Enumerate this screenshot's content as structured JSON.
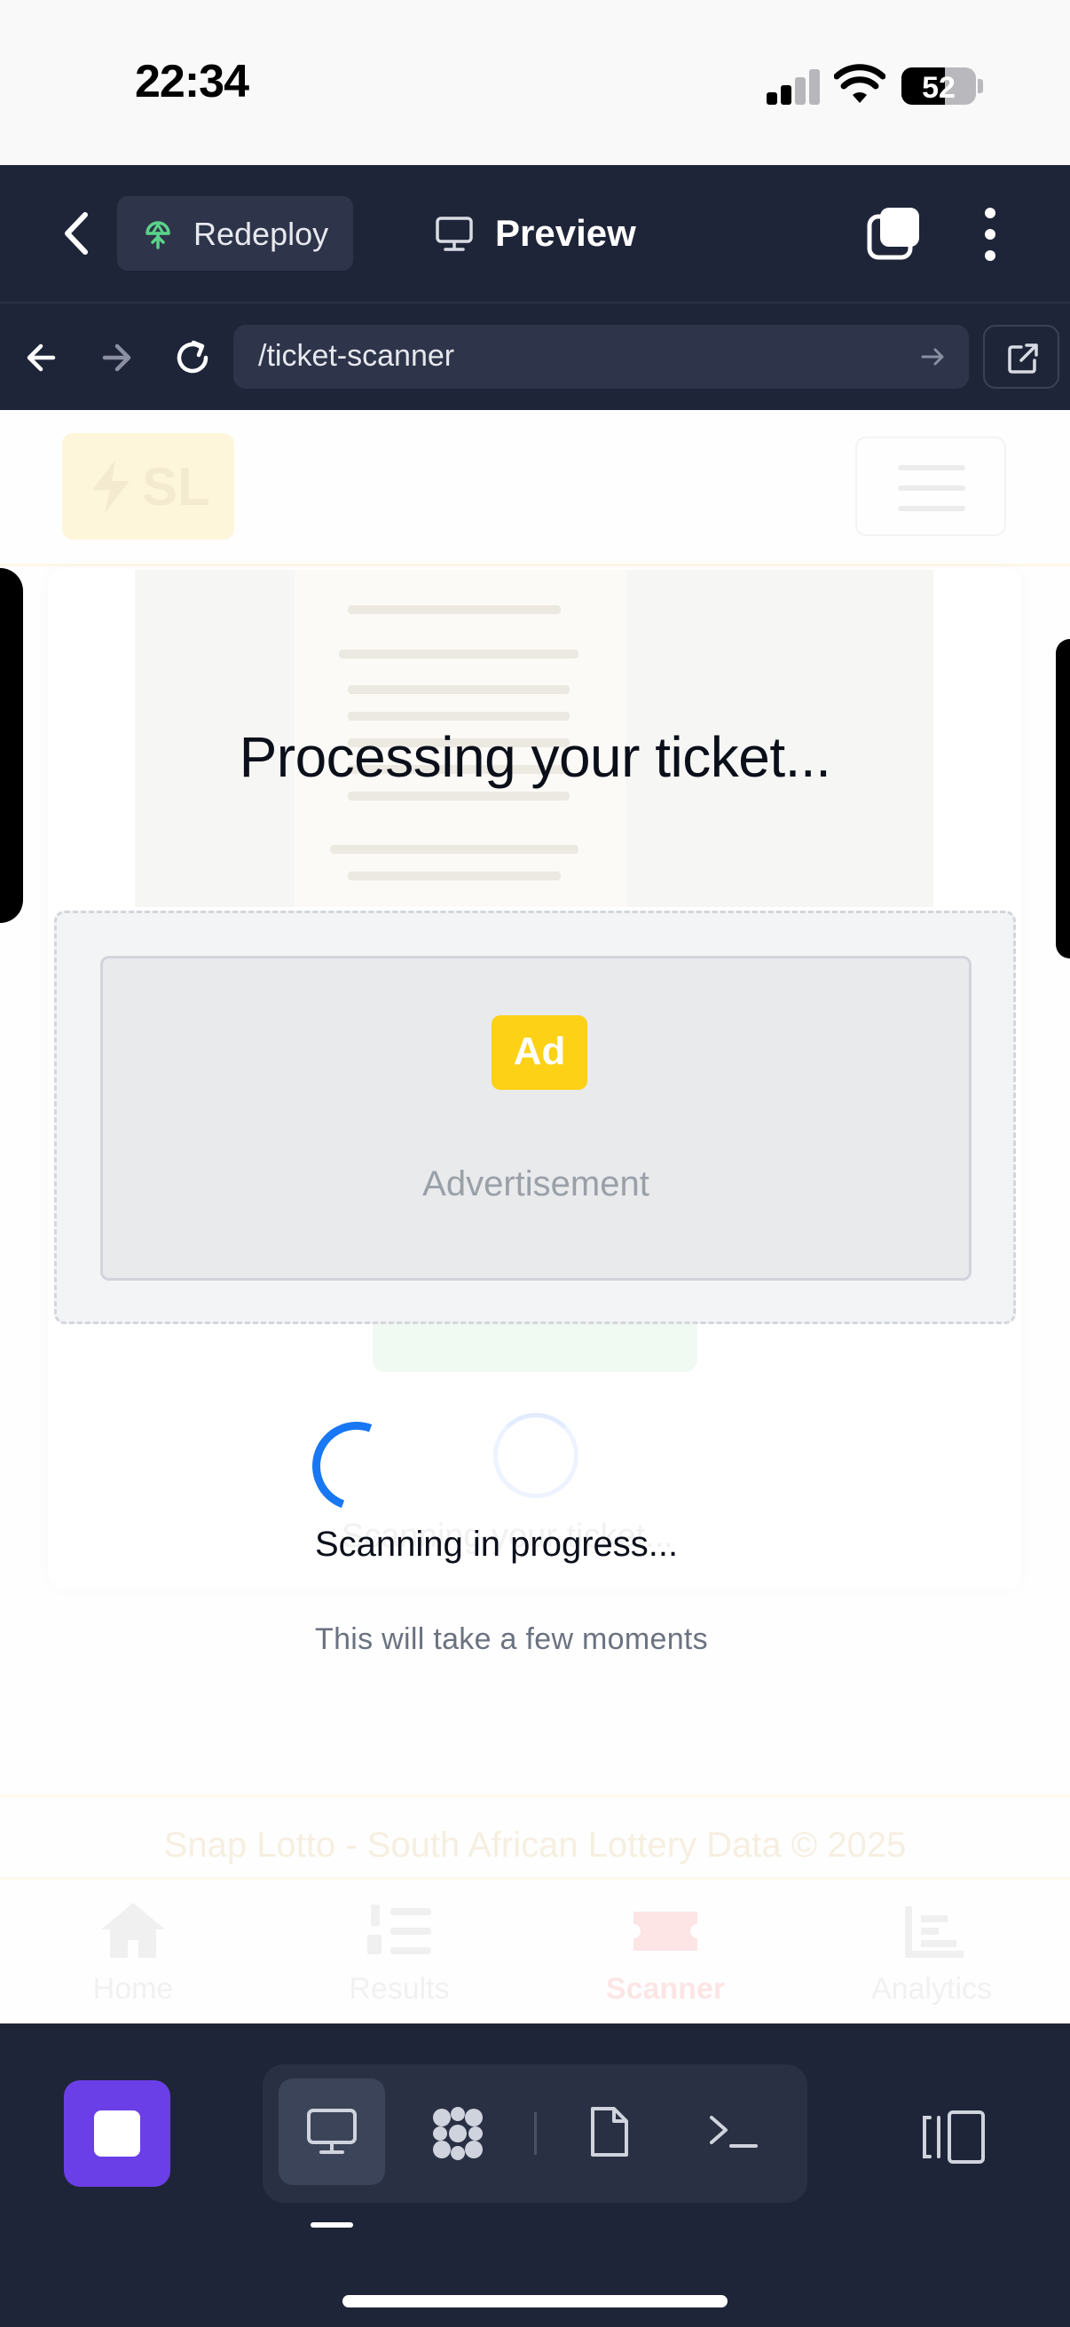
{
  "status_bar": {
    "time": "22:34",
    "battery_level": "52",
    "icons": [
      "cellular-signal-icon",
      "wifi-icon",
      "battery-icon"
    ]
  },
  "ide_header": {
    "redeploy_label": "Redeploy",
    "preview_label": "Preview",
    "icons": [
      "back-chevron-icon",
      "deploy-icon",
      "monitor-icon",
      "tabs-icon",
      "more-vertical-icon"
    ]
  },
  "url_bar": {
    "path": "/ticket-scanner",
    "icons": [
      "arrow-left-icon",
      "arrow-right-icon",
      "reload-icon",
      "go-arrow-icon",
      "external-link-icon"
    ]
  },
  "app": {
    "brand": "SL",
    "footer_text": "Snap Lotto - South African Lottery Data © 2025",
    "bottom_nav": [
      {
        "label": "Home",
        "icon": "home-icon"
      },
      {
        "label": "Results",
        "icon": "numbered-list-icon"
      },
      {
        "label": "Scanner",
        "icon": "ticket-icon"
      },
      {
        "label": "Analytics",
        "icon": "bar-chart-icon"
      }
    ],
    "faded_scan_text": "Scanning your ticket..."
  },
  "overlay": {
    "title": "Processing your ticket...",
    "ad_badge": "Ad",
    "ad_label": "Advertisement",
    "status_text": "Scanning in progress...",
    "sub_text": "This will take a few moments"
  },
  "ide_toolbar": {
    "icons": [
      "stop-icon",
      "monitor-icon",
      "apps-icon",
      "file-icon",
      "terminal-icon",
      "panel-toggle-icon"
    ]
  },
  "colors": {
    "ide_background": "#1f2538",
    "accent_purple": "#6b3fe7",
    "ad_yellow": "#fcd116",
    "spinner_blue": "#1877f2"
  }
}
